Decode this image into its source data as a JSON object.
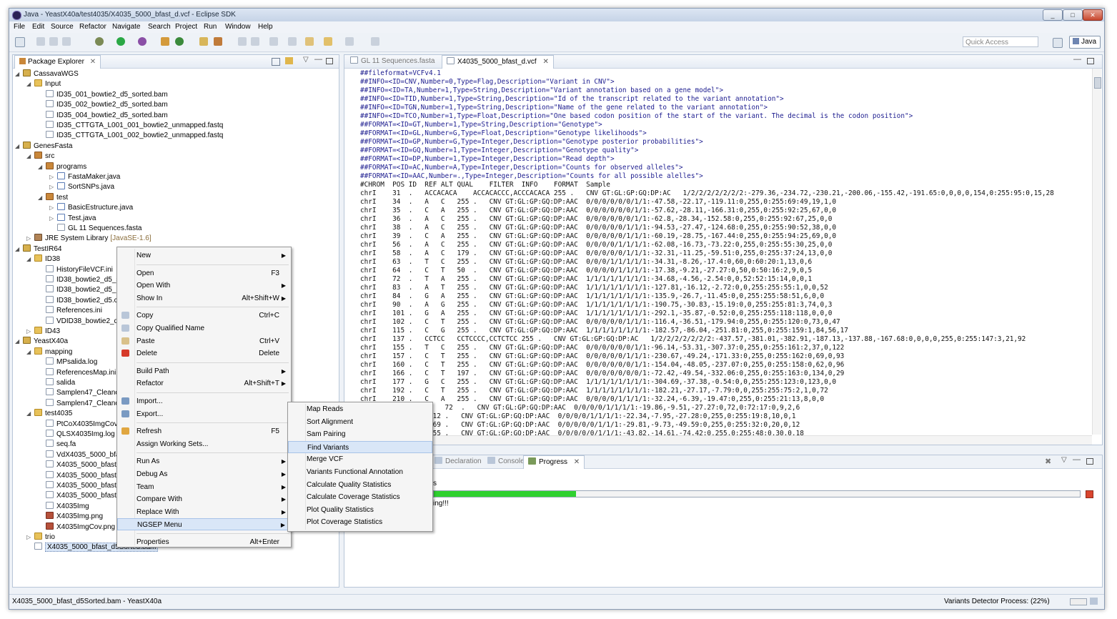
{
  "window": {
    "title": "Java - YeastX40a/test4035/X4035_5000_bfast_d.vcf - Eclipse SDK",
    "minimize": "_",
    "maximize": "□",
    "close": "✕"
  },
  "menubar": [
    "File",
    "Edit",
    "Source",
    "Refactor",
    "Navigate",
    "Search",
    "Project",
    "Run",
    "Window",
    "Help"
  ],
  "toolbar": {
    "quick_access_placeholder": "Quick Access",
    "perspective": "Java"
  },
  "package_explorer": {
    "tab": "Package Explorer",
    "tree": [
      {
        "label": "CassavaWGS",
        "icon": "project-icon",
        "depth": 0,
        "expanded": true
      },
      {
        "label": "Input",
        "icon": "folder-icon",
        "depth": 1,
        "expanded": true
      },
      {
        "label": "ID35_001_bowtie2_d5_sorted.bam",
        "icon": "file-icon",
        "depth": 2
      },
      {
        "label": "ID35_002_bowtie2_d5_sorted.bam",
        "icon": "file-icon",
        "depth": 2
      },
      {
        "label": "ID35_004_bowtie2_d5_sorted.bam",
        "icon": "file-icon",
        "depth": 2
      },
      {
        "label": "ID35_CTTGTA_L001_001_bowtie2_unmapped.fastq",
        "icon": "file-icon",
        "depth": 2
      },
      {
        "label": "ID35_CTTGTA_L001_002_bowtie2_unmapped.fastq",
        "icon": "file-icon",
        "depth": 2
      },
      {
        "label": "GenesFasta",
        "icon": "project-icon",
        "depth": 0,
        "expanded": true
      },
      {
        "label": "src",
        "icon": "package-icon",
        "depth": 1,
        "expanded": true
      },
      {
        "label": "programs",
        "icon": "package-icon",
        "depth": 2,
        "expanded": true
      },
      {
        "label": "FastaMaker.java",
        "icon": "java-file-icon",
        "depth": 3,
        "collapsed": true
      },
      {
        "label": "SortSNPs.java",
        "icon": "java-file-icon",
        "depth": 3,
        "collapsed": true
      },
      {
        "label": "test",
        "icon": "package-icon",
        "depth": 2,
        "expanded": true
      },
      {
        "label": "BasicEstructure.java",
        "icon": "java-file-icon",
        "depth": 3,
        "collapsed": true
      },
      {
        "label": "Test.java",
        "icon": "java-file-icon",
        "depth": 3,
        "collapsed": true
      },
      {
        "label": "GL 11 Sequences.fasta",
        "icon": "file-icon",
        "depth": 3
      },
      {
        "label": "JRE System Library",
        "suffix": "[JavaSE-1.6]",
        "icon": "library-icon",
        "depth": 1,
        "collapsed": true
      },
      {
        "label": "TestIR64",
        "icon": "project-icon",
        "depth": 0,
        "expanded": true
      },
      {
        "label": "ID38",
        "icon": "folder-icon",
        "depth": 1,
        "expanded": true
      },
      {
        "label": "HistoryFileVCF.ini",
        "icon": "file-icon",
        "depth": 2
      },
      {
        "label": "ID38_bowtie2_d5_s",
        "icon": "file-icon",
        "depth": 2
      },
      {
        "label": "ID38_bowtie2_d5_S",
        "icon": "file-icon",
        "depth": 2
      },
      {
        "label": "ID38_bowtie2_d5.c",
        "icon": "file-icon",
        "depth": 2
      },
      {
        "label": "References.ini",
        "icon": "file-icon",
        "depth": 2
      },
      {
        "label": "VDID38_bowtie2_d",
        "icon": "file-icon",
        "depth": 2
      },
      {
        "label": "ID43",
        "icon": "folder-icon",
        "depth": 1,
        "collapsed": true
      },
      {
        "label": "YeastX40a",
        "icon": "project-icon",
        "depth": 0,
        "expanded": true
      },
      {
        "label": "mapping",
        "icon": "folder-icon",
        "depth": 1,
        "expanded": true
      },
      {
        "label": "MPsalida.log",
        "icon": "file-icon",
        "depth": 2
      },
      {
        "label": "ReferencesMap.ini",
        "icon": "file-icon",
        "depth": 2
      },
      {
        "label": "salida",
        "icon": "file-icon",
        "depth": 2
      },
      {
        "label": "Samplen47_Cleanc",
        "icon": "file-icon",
        "depth": 2
      },
      {
        "label": "Samplen47_Cleanc",
        "icon": "file-icon",
        "depth": 2
      },
      {
        "label": "test4035",
        "icon": "folder-icon",
        "depth": 1,
        "expanded": true
      },
      {
        "label": "PtCoX4035ImgCov",
        "icon": "file-icon",
        "depth": 2
      },
      {
        "label": "QLSX4035Img.log",
        "icon": "file-icon",
        "depth": 2
      },
      {
        "label": "seq.fa",
        "icon": "file-icon",
        "depth": 2
      },
      {
        "label": "VdX4035_5000_bfa",
        "icon": "file-icon",
        "depth": 2
      },
      {
        "label": "X4035_5000_bfast_",
        "icon": "file-icon",
        "depth": 2
      },
      {
        "label": "X4035_5000_bfast_",
        "icon": "file-icon",
        "depth": 2
      },
      {
        "label": "X4035_5000_bfast_",
        "icon": "file-icon",
        "depth": 2
      },
      {
        "label": "X4035_5000_bfast_",
        "icon": "file-icon",
        "depth": 2
      },
      {
        "label": "X4035Img",
        "icon": "file-icon",
        "depth": 2
      },
      {
        "label": "X4035Img.png",
        "icon": "image-icon",
        "depth": 2
      },
      {
        "label": "X4035ImgCov.png",
        "icon": "image-icon",
        "depth": 2
      },
      {
        "label": "trio",
        "icon": "folder-icon",
        "depth": 1,
        "collapsed": true
      },
      {
        "label": "X4035_5000_bfast_d5Sorted.bam",
        "icon": "file-icon",
        "depth": 1,
        "selected": true
      }
    ]
  },
  "editor": {
    "tabs": [
      {
        "label": "GL 11 Sequences.fasta",
        "active": false
      },
      {
        "label": "X4035_5000_bfast_d.vcf",
        "active": true
      }
    ],
    "lines": [
      "##fileformat=VCFv4.1",
      "##INFO=<ID=CNV,Number=0,Type=Flag,Description=\"Variant in CNV\">",
      "##INFO=<ID=TA,Number=1,Type=String,Description=\"Variant annotation based on a gene model\">",
      "##INFO=<ID=TID,Number=1,Type=String,Description=\"Id of the transcript related to the variant annotation\">",
      "##INFO=<ID=TGN,Number=1,Type=String,Description=\"Name of the gene related to the variant annotation\">",
      "##INFO=<ID=TCO,Number=1,Type=Float,Description=\"One based codon position of the start of the variant. The decimal is the codon position\">",
      "##FORMAT=<ID=GT,Number=1,Type=String,Description=\"Genotype\">",
      "##FORMAT=<ID=GL,Number=G,Type=Float,Description=\"Genotype likelihoods\">",
      "##FORMAT=<ID=GP,Number=G,Type=Integer,Description=\"Genotype posterior probabilities\">",
      "##FORMAT=<ID=GQ,Number=1,Type=Integer,Description=\"Genotype quality\">",
      "##FORMAT=<ID=DP,Number=1,Type=Integer,Description=\"Read depth\">",
      "##FORMAT=<ID=AC,Number=A,Type=Integer,Description=\"Counts for observed alleles\">",
      "##FORMAT=<ID=AAC,Number=.,Type=Integer,Description=\"Counts for all possible alelles\">",
      "#CHROM  POS ID  REF ALT QUAL    FILTER  INFO    FORMAT  Sample",
      "chrI    31  .   ACCACACA    ACCACACCC,ACCCACACA 255 .   CNV GT:GL:GP:GQ:DP:AC   1/2/2/2/2/2/2/2:-279.36,-234.72,-230.21,-200.06,-155.42,-191.65:0,0,0,0,154,0:255:95:0,15,28",
      "chrI    34  .   A   C   255 .   CNV GT:GL:GP:GQ:DP:AAC  0/0/0/0/0/0/1/1:-47.58,-22.17,-119.11:0,255,0:255:69:49,19,1,0",
      "chrI    35  .   C   A   255 .   CNV GT:GL:GP:GQ:DP:AAC  0/0/0/0/0/0/1/1:-57.62,-28.11,-166.31:0,255,0:255:92:25,67,0,0",
      "chrI    36  .   A   C   255 .   CNV GT:GL:GP:GQ:DP:AAC  0/0/0/0/0/0/1/1:-62.8,-28.34,-152.58:0,255,0:255:92:67,25,0,0",
      "chrI    38  .   A   C   255 .   CNV GT:GL:GP:GQ:DP:AAC  0/0/0/0/0/1/1/1:-94.53,-27.47,-124.68:0,255,0:255:90:52,38,0,0",
      "chrI    39  .   C   A   255 .   CNV GT:GL:GP:GQ:DP:AAC  0/0/0/0/0/1/1/1:-60.19,-28.75,-167.44:0,255,0:255:94:25,69,0,0",
      "chrI    56  .   A   C   255 .   CNV GT:GL:GP:GQ:DP:AAC  0/0/0/0/1/1/1/1:-62.08,-16.73,-73.22:0,255,0:255:55:30,25,0,0",
      "chrI    58  .   A   C   179 .   CNV GT:GL:GP:GQ:DP:AAC  0/0/0/0/0/1/1/1:-32.31,-11.25,-59.51:0,255,0:255:37:24,13,0,0",
      "chrI    63  .   T   C   255 .   CNV GT:GL:GP:GQ:DP:AAC  0/0/0/1/1/1/1/1:-34.31,-8.26,-17.4:0,60,0:60:20:1,13,0,6",
      "chrI    64  .   C   T   50  .   CNV GT:GL:GP:GQ:DP:AAC  0/0/0/0/1/1/1/1:-17.38,-9.21,-27.27:0,50,0:50:16:2,9,0,5",
      "chrI    72  .   T   A   255 .   CNV GT:GL:GP:GQ:DP:AAC  1/1/1/1/1/1/1/1:-34.68,-4.56,-2.54:0,0,52:52:15:14,0,0,1",
      "chrI    83  .   A   T   255 .   CNV GT:GL:GP:GQ:DP:AAC  1/1/1/1/1/1/1/1:-127.81,-16.12,-2.72:0,0,255:255:55:1,0,0,52",
      "chrI    84  .   G   A   255 .   CNV GT:GL:GP:GQ:DP:AAC  1/1/1/1/1/1/1/1:-135.9,-26.7,-11.45:0,0,255:255:58:51,6,0,0",
      "chrI    90  .   A   G   255 .   CNV GT:GL:GP:GQ:DP:AAC  1/1/1/1/1/1/1/1:-190.75,-30.83,-15.19:0,0,255:255:81:3,74,0,3",
      "chrI    101 .   G   A   255 .   CNV GT:GL:GP:GQ:DP:AAC  1/1/1/1/1/1/1/1:-292.1,-35.87,-0.52:0,0,255:255:118:118,0,0,0",
      "chrI    102 .   C   T   255 .   CNV GT:GL:GP:GQ:DP:AAC  0/0/0/0/0/1/1/1:-116.4,-36.51,-179.94:0,255,0:255:120:0,73,0,47",
      "chrI    115 .   C   G   255 .   CNV GT:GL:GP:GQ:DP:AAC  1/1/1/1/1/1/1/1:-182.57,-86.04,-251.81:0,255,0:255:159:1,84,56,17",
      "chrI    137 .   CCTCC   CCTCCCC,CCTCTCC 255 .   CNV GT:GL:GP:GQ:DP:AC   1/2/2/2/2/2/2/2:-437.57,-381.01,-382.91,-187.13,-137.88,-167.68:0,0,0,0,255,0:255:147:3,21,92",
      "chrI    155 .   T   C   255 .   CNV GT:GL:GP:GQ:DP:AAC  0/0/0/0/0/0/1/1:-96.14,-53.31,-307.37:0,255,0:255:161:2,37,0,122",
      "chrI    157 .   C   T   255 .   CNV GT:GL:GP:GQ:DP:AAC  0/0/0/0/0/1/1/1:-230.67,-49.24,-171.33:0,255,0:255:162:0,69,0,93",
      "chrI    160 .   C   T   255 .   CNV GT:GL:GP:GQ:DP:AAC  0/0/0/0/0/0/1/1:-154.04,-48.05,-237.07:0,255,0:255:158:0,62,0,96",
      "chrI    166 .   C   T   197 .   CNV GT:GL:GP:GQ:DP:AAC  0/0/0/0/0/0/0/1:-72.42,-49.54,-332.06:0,255,0:255:163:0,134,0,29",
      "chrI    177 .   G   C   255 .   CNV GT:GL:GP:GQ:DP:AAC  1/1/1/1/1/1/1/1:-304.69,-37.38,-0.54:0,0,255:255:123:0,123,0,0",
      "chrI    192 .   C   T   255 .   CNV GT:GL:GP:GQ:DP:AAC  1/1/1/1/1/1/1/1:-182.21,-27.17,-7.79:0,0,255:255:75:2,1,0,72",
      "chrI    210 .   C   A   255 .   CNV GT:GL:GP:GQ:DP:AAC  0/0/0/0/1/1/1/1:-32.24,-6.39,-19.47:0,255,0:255:21:13,8,0,0",
      "chrI    ...      T   72  .   CNV GT:GL:GP:GQ:DP:AAC  0/0/0/0/1/1/1/1:-19.86,-9.51,-27.27:0,72,0:72:17:0,9,2,6",
      "chrI    ...  A   112 .   CNV GT:GL:GP:GQ:DP:AAC  0/0/0/0/1/1/1/1:-22.34,-7.95,-27.28:0,255,0:255:19:8,10,0,1",
      "chrI    ...  T   169 .   CNV GT:GL:GP:GQ:DP:AAC  0/0/0/0/0/1/1/1:-29.81,-9.73,-49.59:0,255,0:255:32:0,20,0,12",
      "chrI    ...  T   255 .   CNV GT:GL:GP:GQ:DP:AAC  0/0/0/0/0/1/1/1:-43.82,-14.61,-74.42:0,255,0:255:48:0,30,0,18"
    ]
  },
  "bottom_panel": {
    "tabs": [
      {
        "label": "Declaration",
        "active": false
      },
      {
        "label": "Console",
        "active": false
      },
      {
        "label": "Progress",
        "active": true
      }
    ],
    "progress_text_fragment": "s",
    "progress_status_fragment": "ing!!!",
    "progress_fraction": 0.22
  },
  "context_menu": {
    "items": [
      {
        "label": "New",
        "shortcut": "",
        "submenu": true
      },
      {
        "sep": true
      },
      {
        "label": "Open",
        "shortcut": "F3"
      },
      {
        "label": "Open With",
        "shortcut": "",
        "submenu": true
      },
      {
        "label": "Show In",
        "shortcut": "Alt+Shift+W",
        "submenu": true
      },
      {
        "sep": true
      },
      {
        "label": "Copy",
        "shortcut": "Ctrl+C",
        "icon": "copy-icon"
      },
      {
        "label": "Copy Qualified Name",
        "shortcut": "",
        "icon": "copy-qualified-icon"
      },
      {
        "label": "Paste",
        "shortcut": "Ctrl+V",
        "icon": "paste-icon"
      },
      {
        "label": "Delete",
        "shortcut": "Delete",
        "icon": "delete-icon"
      },
      {
        "sep": true
      },
      {
        "label": "Build Path",
        "shortcut": "",
        "submenu": true
      },
      {
        "label": "Refactor",
        "shortcut": "Alt+Shift+T",
        "submenu": true
      },
      {
        "sep": true
      },
      {
        "label": "Import...",
        "shortcut": "",
        "icon": "import-icon"
      },
      {
        "label": "Export...",
        "shortcut": "",
        "icon": "export-icon"
      },
      {
        "sep": true
      },
      {
        "label": "Refresh",
        "shortcut": "F5",
        "icon": "refresh-icon"
      },
      {
        "label": "Assign Working Sets...",
        "shortcut": ""
      },
      {
        "sep": true
      },
      {
        "label": "Run As",
        "shortcut": "",
        "submenu": true
      },
      {
        "label": "Debug As",
        "shortcut": "",
        "submenu": true
      },
      {
        "label": "Team",
        "shortcut": "",
        "submenu": true
      },
      {
        "label": "Compare With",
        "shortcut": "",
        "submenu": true
      },
      {
        "label": "Replace With",
        "shortcut": "",
        "submenu": true
      },
      {
        "label": "NGSEP Menu",
        "shortcut": "",
        "submenu": true,
        "highlighted": true
      },
      {
        "sep": true
      },
      {
        "label": "Properties",
        "shortcut": "Alt+Enter"
      }
    ]
  },
  "submenu": {
    "items": [
      {
        "label": "Map Reads"
      },
      {
        "label": "Sort Alignment"
      },
      {
        "label": "Sam Pairing"
      },
      {
        "label": "Find Variants",
        "highlighted": true
      },
      {
        "label": "Merge VCF"
      },
      {
        "label": "Variants Functional Annotation"
      },
      {
        "label": "Calculate Quality Statistics"
      },
      {
        "label": "Calculate Coverage Statistics"
      },
      {
        "label": "Plot Quality Statistics"
      },
      {
        "label": "Plot Coverage Statistics"
      }
    ]
  },
  "statusbar": {
    "left": "X4035_5000_bfast_d5Sorted.bam - YeastX40a",
    "right": "Variants Detector Process: (22%)"
  },
  "colors": {
    "progress_green": "#2fd12f",
    "selection_blue": "#d9e6f7",
    "frame_blue": "#c6d4e7"
  }
}
